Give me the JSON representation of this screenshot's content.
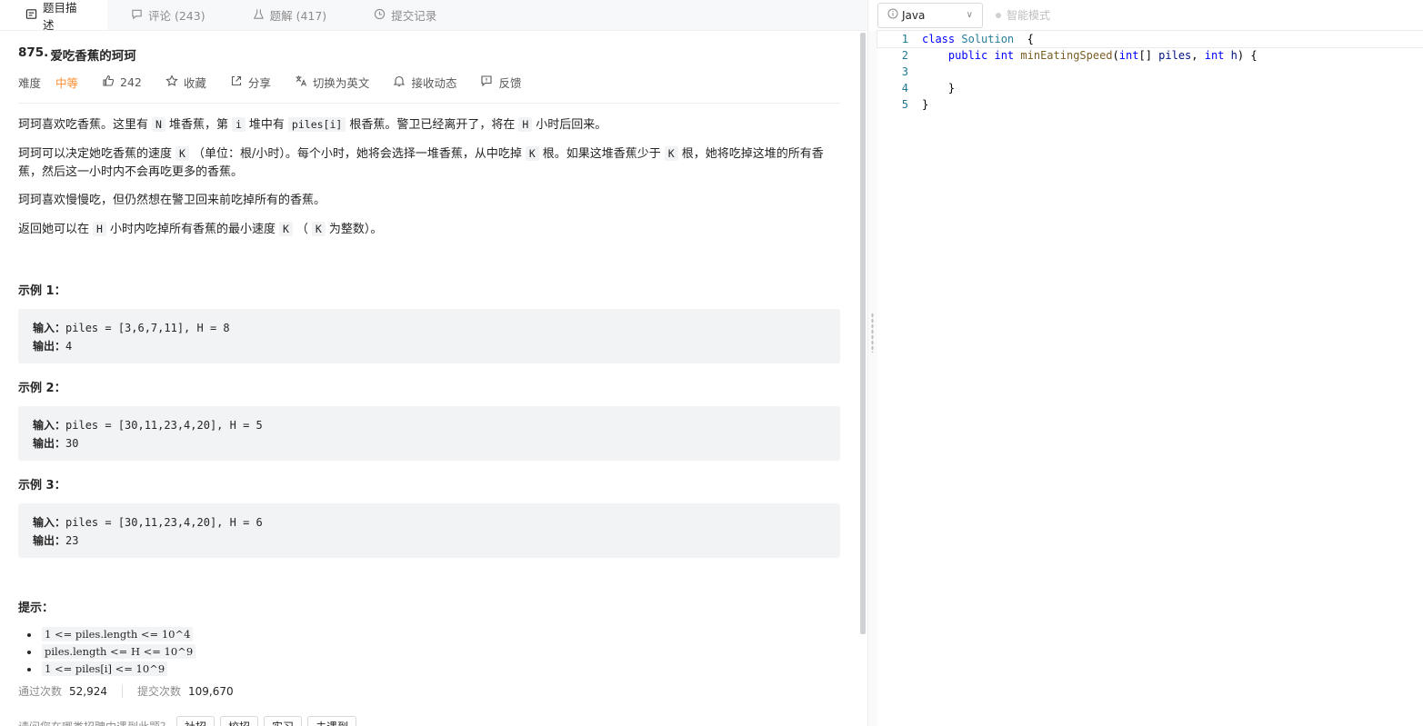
{
  "tabs": [
    {
      "label": "题目描述",
      "icon": "description-icon"
    },
    {
      "label": "评论 (243)",
      "icon": "comment-icon"
    },
    {
      "label": "题解 (417)",
      "icon": "flask-icon"
    },
    {
      "label": "提交记录",
      "icon": "clock-icon"
    }
  ],
  "problem": {
    "number": "875.",
    "title": "爱吃香蕉的珂珂",
    "difficulty_label": "难度",
    "difficulty": "中等",
    "likes": "242",
    "actions": {
      "collect": "收藏",
      "share": "分享",
      "switch_lang": "切换为英文",
      "notify": "接收动态",
      "feedback": "反馈"
    },
    "p1": {
      "a": "珂珂喜欢吃香蕉。这里有",
      "N": "N",
      "b": "堆香蕉，第",
      "i": "i",
      "c": "堆中有",
      "piles": "piles[i]",
      "d": "根香蕉。警卫已经离开了，将在",
      "H": "H",
      "e": "小时后回来。"
    },
    "p2": {
      "a": "珂珂可以决定她吃香蕉的速度",
      "K1": "K",
      "b": "（单位：根/小时）。每个小时，她将会选择一堆香蕉，从中吃掉",
      "K2": "K",
      "c": "根。如果这堆香蕉少于",
      "K3": "K",
      "d": "根，她将吃掉这堆的所有香蕉，然后这一小时内不会再吃更多的香蕉。"
    },
    "p3": "珂珂喜欢慢慢吃，但仍然想在警卫回来前吃掉所有的香蕉。",
    "p4": {
      "a": "返回她可以在",
      "H": "H",
      "b": "小时内吃掉所有香蕉的最小速度",
      "K1": "K",
      "c": "（",
      "K2": "K",
      "d": "为整数）。"
    },
    "examples": [
      {
        "heading": "示例 1：",
        "in_label": "输入：",
        "input": "piles = [3,6,7,11], H = 8",
        "out_label": "输出：",
        "output": "4"
      },
      {
        "heading": "示例 2：",
        "in_label": "输入：",
        "input": "piles = [30,11,23,4,20], H = 5",
        "out_label": "输出：",
        "output": "30"
      },
      {
        "heading": "示例 3：",
        "in_label": "输入：",
        "input": "piles = [30,11,23,4,20], H = 6",
        "out_label": "输出：",
        "output": "23"
      }
    ],
    "hints_title": "提示：",
    "hints": [
      "1 <= piles.length <= 10^4",
      "piles.length <= H <= 10^9",
      "1 <= piles[i] <= 10^9"
    ],
    "stats": {
      "accepted_label": "通过次数",
      "accepted": "52,924",
      "submitted_label": "提交次数",
      "submitted": "109,670"
    },
    "ask": {
      "text": "请问您在哪类招聘中遇到此题？",
      "options": [
        "社招",
        "校招",
        "实习",
        "未遇到"
      ]
    }
  },
  "editor": {
    "language": "Java",
    "smart_mode": "智能模式",
    "lines": [
      {
        "n": "1",
        "tokens": [
          [
            "kw",
            "class "
          ],
          [
            "ty",
            "Solution"
          ],
          [
            "",
            "  {"
          ]
        ]
      },
      {
        "n": "2",
        "tokens": [
          [
            "",
            "    "
          ],
          [
            "kw",
            "public "
          ],
          [
            "kw",
            "int "
          ],
          [
            "fn",
            "minEatingSpeed"
          ],
          [
            "",
            "("
          ],
          [
            "kw",
            "int"
          ],
          [
            "",
            "[] "
          ],
          [
            "pm",
            "piles"
          ],
          [
            "",
            ", "
          ],
          [
            "kw",
            "int "
          ],
          [
            "pm",
            "h"
          ],
          [
            "",
            ") {"
          ]
        ]
      },
      {
        "n": "3",
        "tokens": [
          [
            "",
            ""
          ]
        ]
      },
      {
        "n": "4",
        "tokens": [
          [
            "",
            "    }"
          ]
        ]
      },
      {
        "n": "5",
        "tokens": [
          [
            "",
            "}"
          ]
        ]
      }
    ]
  }
}
